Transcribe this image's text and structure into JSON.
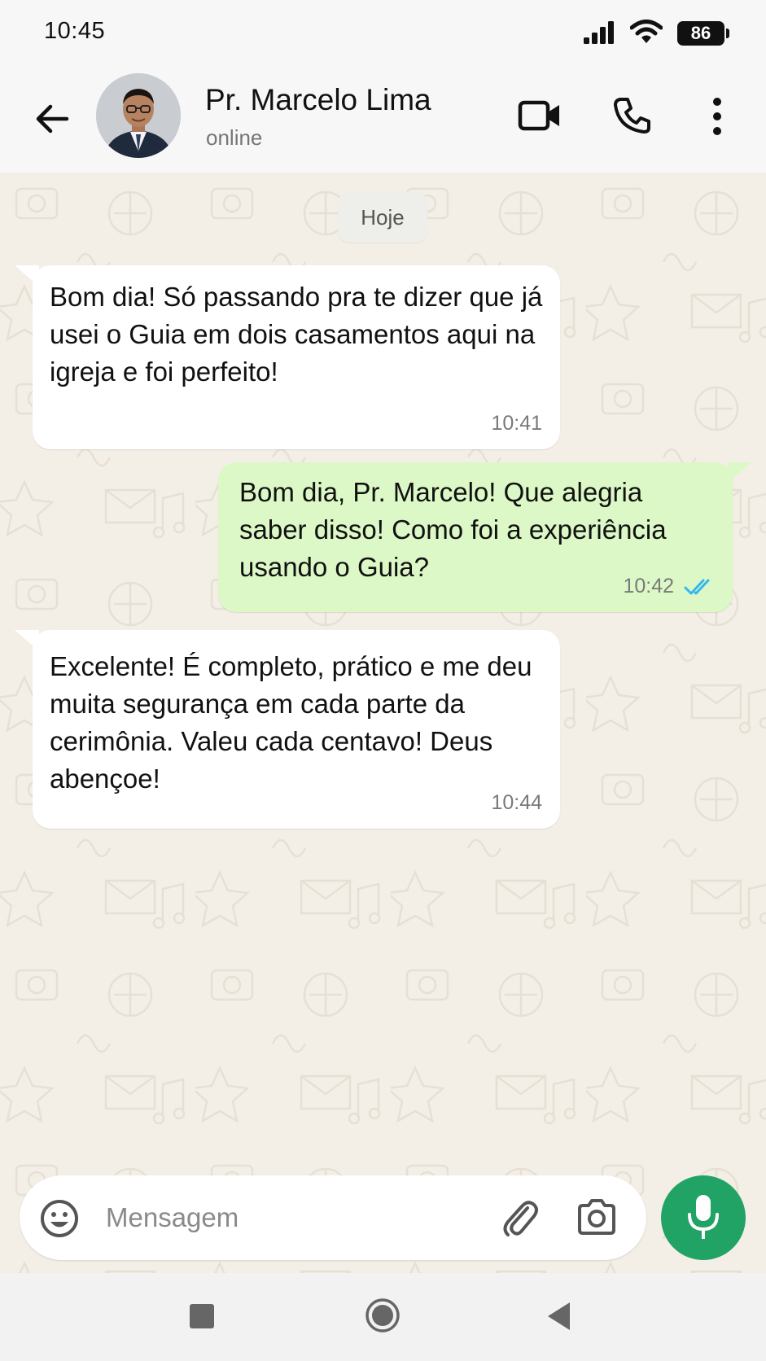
{
  "status_bar": {
    "time": "10:45",
    "battery": "86"
  },
  "header": {
    "contact_name": "Pr. Marcelo Lima",
    "contact_status": "online",
    "icons": [
      "back-arrow-icon",
      "video-call-icon",
      "phone-icon",
      "more-vertical-icon"
    ]
  },
  "chat": {
    "date_chip": "Hoje",
    "messages": [
      {
        "direction": "incoming",
        "text": "Bom dia! Só passando pra te dizer que já usei o Guia em dois casamentos aqui na igreja e foi perfeito!",
        "time": "10:41"
      },
      {
        "direction": "outgoing",
        "text": "Bom dia, Pr. Marcelo! Que alegria saber disso! Como foi a experiência usando o Guia?",
        "time": "10:42",
        "status": "read"
      },
      {
        "direction": "incoming",
        "text": "Excelente! É completo, prático e me deu muita segurança em cada parte da cerimônia. Valeu cada centavo! Deus abençoe!",
        "time": "10:44"
      }
    ]
  },
  "composer": {
    "placeholder": "Mensagem",
    "value": ""
  },
  "colors": {
    "incoming_bubble": "#ffffff",
    "outgoing_bubble": "#dcf8c6",
    "chat_background": "#f3efe7",
    "mic_button": "#21a366",
    "read_ticks": "#34b7f1"
  }
}
